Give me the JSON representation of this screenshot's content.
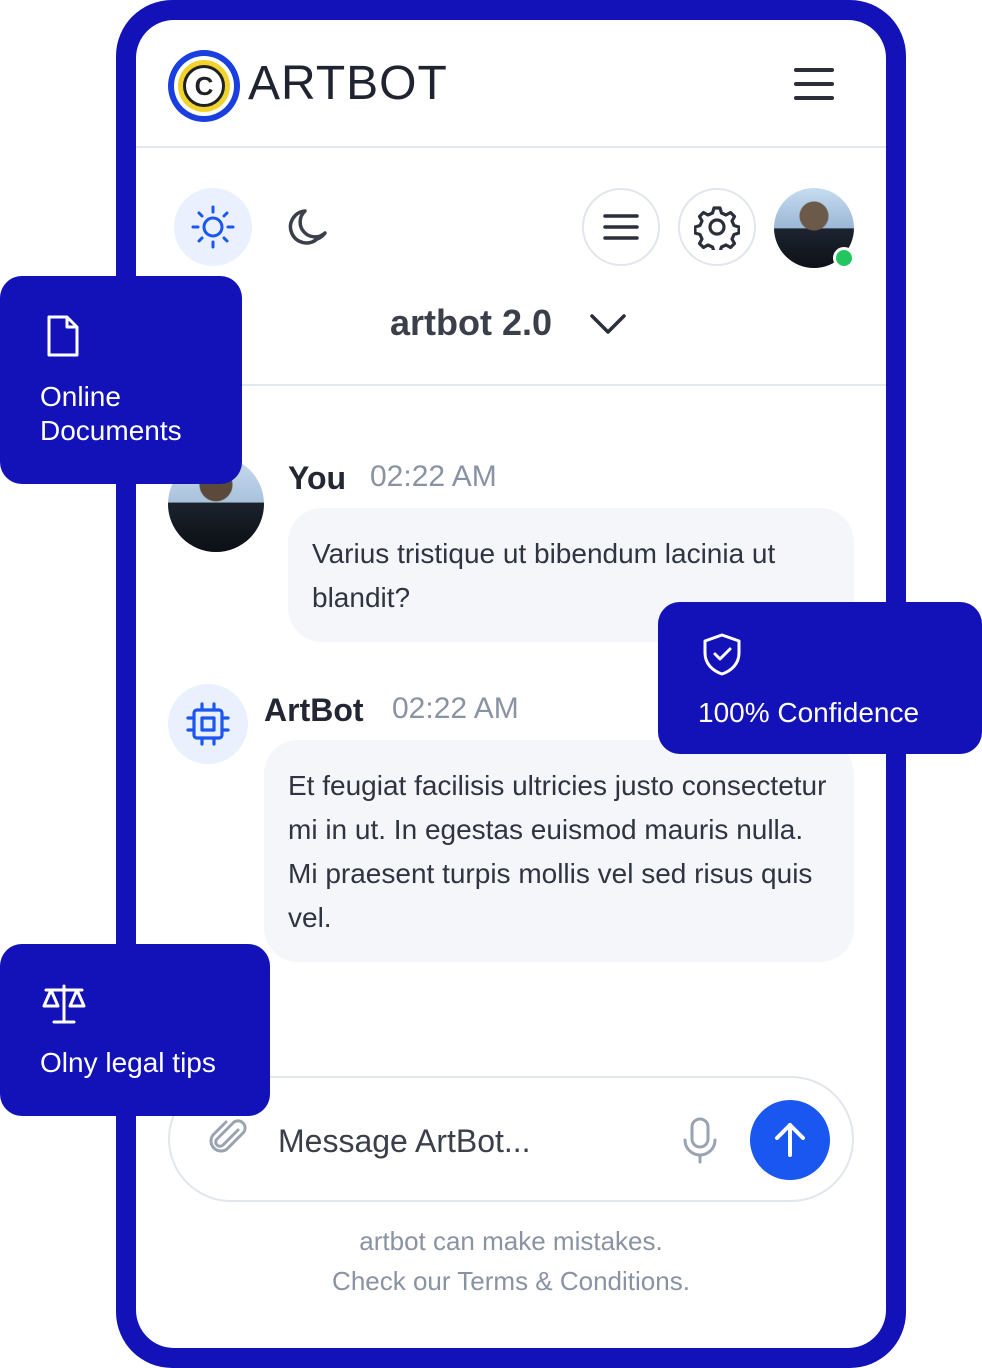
{
  "header": {
    "brand": "ARTBOT",
    "logo_letter": "C"
  },
  "toolbar": {
    "model_name": "artbot 2.0"
  },
  "chat": [
    {
      "author": "You",
      "time": "02:22 AM",
      "text": "Varius tristique ut bibendum lacinia ut blandit?"
    },
    {
      "author": "ArtBot",
      "time": "02:22 AM",
      "text": "Et feugiat facilisis ultricies justo consectetur mi in ut. In egestas euismod mauris nulla. Mi praesent turpis mollis vel sed risus quis vel."
    }
  ],
  "composer": {
    "placeholder": "Message ArtBot..."
  },
  "disclaimer": {
    "line1": "artbot can make mistakes.",
    "line2": "Check our Terms & Conditions."
  },
  "features": {
    "online_documents": "Online Documents",
    "confidence": "100% Confidence",
    "legal_tips": "Olny legal tips"
  },
  "colors": {
    "frame": "#1212b8",
    "accent": "#1a56f0",
    "online": "#22c55e"
  },
  "icons": [
    "logo-icon",
    "menu-icon",
    "sun-icon",
    "moon-icon",
    "list-icon",
    "gear-icon",
    "chevron-down-icon",
    "chip-icon",
    "paperclip-icon",
    "mic-icon",
    "arrow-up-icon",
    "document-icon",
    "shield-check-icon",
    "scales-icon"
  ]
}
